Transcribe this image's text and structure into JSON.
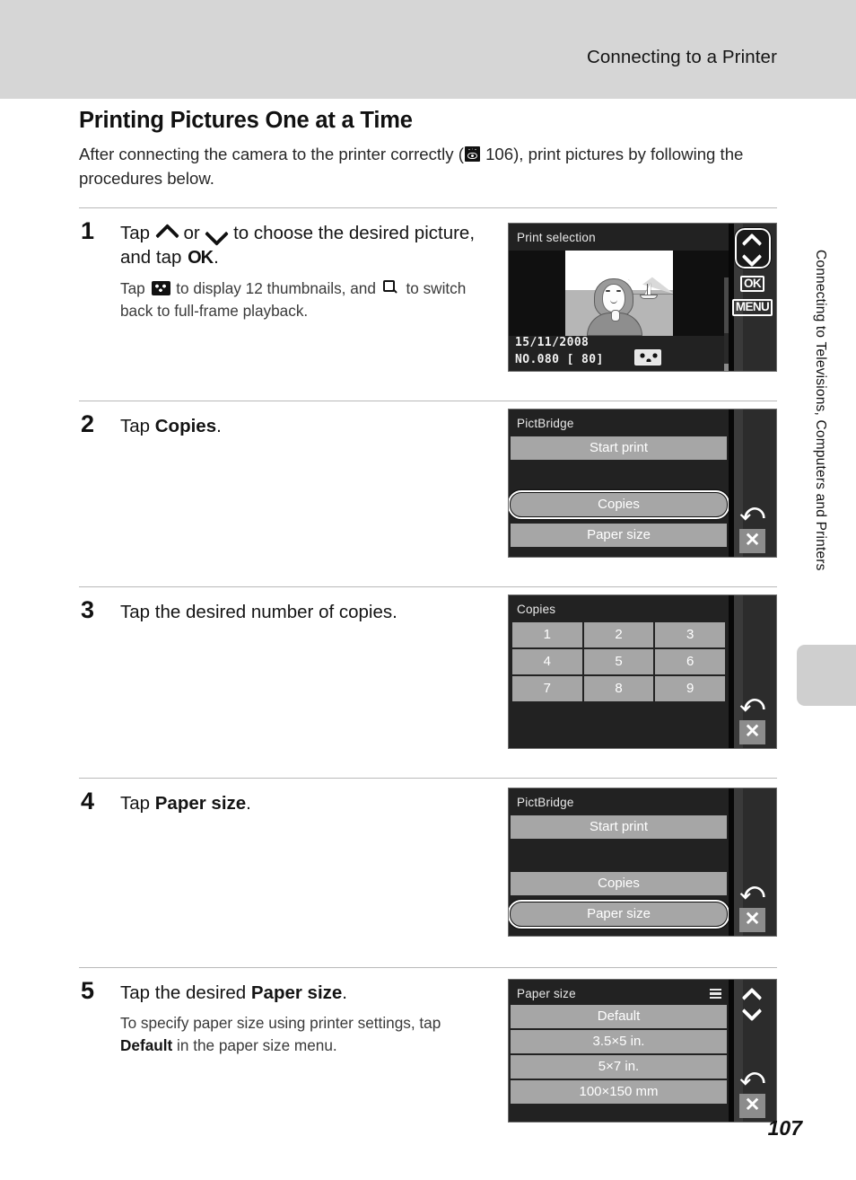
{
  "header": {
    "running_head": "Connecting to a Printer"
  },
  "side_index": {
    "label": "Connecting to Televisions, Computers and Printers"
  },
  "page": {
    "number": "107",
    "title": "Printing Pictures One at a Time",
    "intro_before": "After connecting the camera to the printer correctly (",
    "intro_ref_icon": "reference-eye-icon",
    "intro_ref_page": "106",
    "intro_after": "), print pictures by following the procedures below."
  },
  "steps": [
    {
      "number": "1",
      "head_part1": "Tap ",
      "head_icon_up": "chevron-up-icon",
      "head_part2": " or ",
      "head_icon_down": "chevron-down-icon",
      "head_part3": " to choose the desired picture, and tap ",
      "head_ok": "OK",
      "head_part4": ".",
      "sub_part1": "Tap ",
      "sub_icon_thumb": "thumbnail-grid-icon",
      "sub_part2": " to display 12 thumbnails, and ",
      "sub_icon_zoom": "magnifier-icon",
      "sub_part3": " to switch back to full-frame playback."
    },
    {
      "number": "2",
      "head_part1": "Tap ",
      "head_bold": "Copies",
      "head_part2": "."
    },
    {
      "number": "3",
      "head_part1": "Tap the desired number of copies."
    },
    {
      "number": "4",
      "head_part1": "Tap ",
      "head_bold": "Paper size",
      "head_part2": "."
    },
    {
      "number": "5",
      "head_part1": "Tap the desired ",
      "head_bold": "Paper size",
      "head_part2": ".",
      "sub_part1": "To specify paper size using printer settings, tap ",
      "sub_bold": "Default",
      "sub_part2": " in the paper size menu."
    }
  ],
  "screens": {
    "print_selection": {
      "title": "Print selection",
      "date": "15/11/2008",
      "frame_info": "NO.080 [   80]",
      "thumbnail_badge_icon": "thumbnail-grid-icon",
      "controls": {
        "up": "chevron-up-icon",
        "down": "chevron-down-icon",
        "ok_label": "OK",
        "menu_label": "MENU"
      }
    },
    "pictbridge_copies": {
      "title": "PictBridge",
      "rows": [
        {
          "label": "Start print",
          "selected": false
        },
        {
          "label": "",
          "selected": false,
          "blank": true
        },
        {
          "label": "Copies",
          "selected": true
        },
        {
          "label": "Paper size",
          "selected": false
        }
      ],
      "controls": {
        "back": "back-arrow-icon",
        "close": "close-x-icon"
      }
    },
    "copies": {
      "title": "Copies",
      "keys": [
        "1",
        "2",
        "3",
        "4",
        "5",
        "6",
        "7",
        "8",
        "9"
      ],
      "controls": {
        "back": "back-arrow-icon",
        "close": "close-x-icon"
      }
    },
    "pictbridge_paper": {
      "title": "PictBridge",
      "rows": [
        {
          "label": "Start print",
          "selected": false
        },
        {
          "label": "",
          "selected": false,
          "blank": true
        },
        {
          "label": "Copies",
          "selected": false
        },
        {
          "label": "Paper size",
          "selected": true
        }
      ],
      "controls": {
        "back": "back-arrow-icon",
        "close": "close-x-icon"
      }
    },
    "paper_size": {
      "title": "Paper size",
      "scroll_icon": "list-scroll-icon",
      "rows": [
        {
          "label": "Default"
        },
        {
          "label": "3.5×5 in."
        },
        {
          "label": "5×7 in."
        },
        {
          "label": "100×150 mm"
        }
      ],
      "controls": {
        "up": "chevron-up-icon",
        "down": "chevron-down-icon",
        "back": "back-arrow-icon",
        "close": "close-x-icon"
      }
    }
  },
  "colors": {
    "header_band": "#d6d6d6",
    "screen_bg": "#1c1c1c",
    "menu_row": "#a6a6a6",
    "text": "#1a1a1a"
  }
}
